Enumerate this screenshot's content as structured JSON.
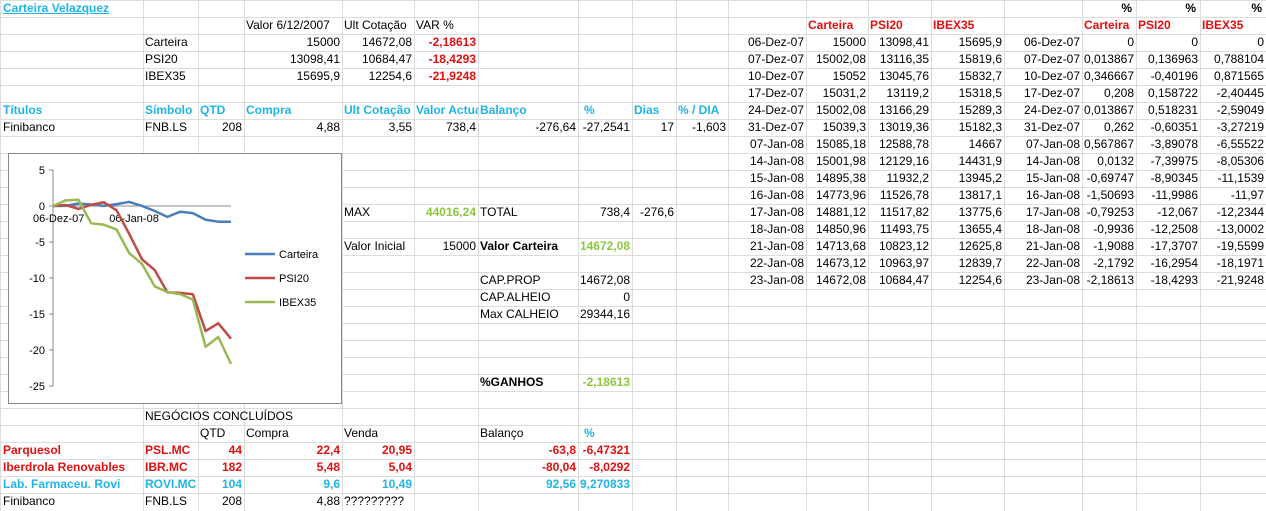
{
  "title": "Carteira Velazquez",
  "summary": {
    "h_valor": "Valor 6/12/2007",
    "h_ult": "Ult Cotação",
    "h_var": "VAR %",
    "rows": [
      {
        "name": "Carteira",
        "valor": "15000",
        "ult": "14672,08",
        "var": "-2,18613"
      },
      {
        "name": "PSI20",
        "valor": "13098,41",
        "ult": "10684,47",
        "var": "-18,4293"
      },
      {
        "name": "IBEX35",
        "valor": "15695,9",
        "ult": "12254,6",
        "var": "-21,9248"
      }
    ]
  },
  "titulos": {
    "headers": [
      "Títulos",
      "Símbolo",
      "QTD",
      "Compra",
      "Ult Cotação",
      "Valor Actual",
      "Balanço",
      "%",
      "Dias",
      "% / DIA"
    ],
    "row": {
      "name": "Finibanco",
      "sym": "FNB.LS",
      "qtd": "208",
      "compra": "4,88",
      "ult": "3,55",
      "valor": "738,4",
      "bal": "-276,64",
      "pct": "-27,2541",
      "dias": "17",
      "pdia": "-1,603"
    }
  },
  "stats": {
    "max_label": "MAX",
    "max_value": "44016,24",
    "total_label": "TOTAL",
    "total_value": "738,4",
    "total_bal": "-276,6",
    "vinicial_label": "Valor Inicial",
    "vinicial_value": "15000",
    "vcart_label": "Valor Carteira",
    "vcart_value": "14672,08",
    "capprop_label": "CAP.PROP",
    "capprop_value": "14672,08",
    "capalh_label": "CAP.ALHEIO",
    "capalh_value": "0",
    "maxcalh_label": "Max CALHEIO",
    "maxcalh_value": "29344,16",
    "ganhos_label": "%GANHOS",
    "ganhos_value": "-2,18613"
  },
  "negocios": {
    "title": "NEGÓCIOS CONCLUÍDOS",
    "headers": {
      "qtd": "QTD",
      "compra": "Compra",
      "venda": "Venda",
      "bal": "Balanço",
      "pct": "%"
    },
    "rows": [
      {
        "name": "Parquesol",
        "sym": "PSL.MC",
        "qtd": "44",
        "compra": "22,4",
        "venda": "20,95",
        "bal": "-63,8",
        "pct": "-6,47321",
        "color": "red"
      },
      {
        "name": "Iberdrola Renovables",
        "sym": "IBR.MC",
        "qtd": "182",
        "compra": "5,48",
        "venda": "5,04",
        "bal": "-80,04",
        "pct": "-8,0292",
        "color": "red"
      },
      {
        "name": "Lab. Farmaceu. Rovi",
        "sym": "ROVI.MC",
        "qtd": "104",
        "compra": "9,6",
        "venda": "10,49",
        "bal": "92,56",
        "pct": "9,270833",
        "color": "cyan"
      },
      {
        "name": "Finibanco",
        "sym": "FNB.LS",
        "qtd": "208",
        "compra": "4,88",
        "venda": "?????????",
        "bal": "",
        "pct": "",
        "color": "black"
      }
    ]
  },
  "history": {
    "headers": [
      "Carteira",
      "PSI20",
      "IBEX35"
    ],
    "pct_row": [
      "%",
      "%",
      "%"
    ],
    "rows": [
      {
        "d": "06-Dez-07",
        "c": "15000",
        "p": "13098,41",
        "i": "15695,9",
        "d2": "06-Dez-07",
        "pc": "0",
        "pp": "0",
        "pi": "0"
      },
      {
        "d": "07-Dez-07",
        "c": "15002,08",
        "p": "13116,35",
        "i": "15819,6",
        "d2": "07-Dez-07",
        "pc": "0,013867",
        "pp": "0,136963",
        "pi": "0,788104"
      },
      {
        "d": "10-Dez-07",
        "c": "15052",
        "p": "13045,76",
        "i": "15832,7",
        "d2": "10-Dez-07",
        "pc": "0,346667",
        "pp": "-0,40196",
        "pi": "0,871565"
      },
      {
        "d": "17-Dez-07",
        "c": "15031,2",
        "p": "13119,2",
        "i": "15318,5",
        "d2": "17-Dez-07",
        "pc": "0,208",
        "pp": "0,158722",
        "pi": "-2,40445"
      },
      {
        "d": "24-Dez-07",
        "c": "15002,08",
        "p": "13166,29",
        "i": "15289,3",
        "d2": "24-Dez-07",
        "pc": "0,013867",
        "pp": "0,518231",
        "pi": "-2,59049"
      },
      {
        "d": "31-Dez-07",
        "c": "15039,3",
        "p": "13019,36",
        "i": "15182,3",
        "d2": "31-Dez-07",
        "pc": "0,262",
        "pp": "-0,60351",
        "pi": "-3,27219"
      },
      {
        "d": "07-Jan-08",
        "c": "15085,18",
        "p": "12588,78",
        "i": "14667",
        "d2": "07-Jan-08",
        "pc": "0,567867",
        "pp": "-3,89078",
        "pi": "-6,55522"
      },
      {
        "d": "14-Jan-08",
        "c": "15001,98",
        "p": "12129,16",
        "i": "14431,9",
        "d2": "14-Jan-08",
        "pc": "0,0132",
        "pp": "-7,39975",
        "pi": "-8,05306"
      },
      {
        "d": "15-Jan-08",
        "c": "14895,38",
        "p": "11932,2",
        "i": "13945,2",
        "d2": "15-Jan-08",
        "pc": "-0,69747",
        "pp": "-8,90345",
        "pi": "-11,1539"
      },
      {
        "d": "16-Jan-08",
        "c": "14773,96",
        "p": "11526,78",
        "i": "13817,1",
        "d2": "16-Jan-08",
        "pc": "-1,50693",
        "pp": "-11,9986",
        "pi": "-11,97"
      },
      {
        "d": "17-Jan-08",
        "c": "14881,12",
        "p": "11517,82",
        "i": "13775,6",
        "d2": "17-Jan-08",
        "pc": "-0,79253",
        "pp": "-12,067",
        "pi": "-12,2344"
      },
      {
        "d": "18-Jan-08",
        "c": "14850,96",
        "p": "11493,75",
        "i": "13655,4",
        "d2": "18-Jan-08",
        "pc": "-0,9936",
        "pp": "-12,2508",
        "pi": "-13,0002"
      },
      {
        "d": "21-Jan-08",
        "c": "14713,68",
        "p": "10823,12",
        "i": "12625,8",
        "d2": "21-Jan-08",
        "pc": "-1,9088",
        "pp": "-17,3707",
        "pi": "-19,5599"
      },
      {
        "d": "22-Jan-08",
        "c": "14673,12",
        "p": "10963,97",
        "i": "12839,7",
        "d2": "22-Jan-08",
        "pc": "-2,1792",
        "pp": "-16,2954",
        "pi": "-18,1971"
      },
      {
        "d": "23-Jan-08",
        "c": "14672,08",
        "p": "10684,47",
        "i": "12254,6",
        "d2": "23-Jan-08",
        "pc": "-2,18613",
        "pp": "-18,4293",
        "pi": "-21,9248"
      }
    ]
  },
  "chart_data": {
    "type": "line",
    "x": [
      "06-Dez-07",
      "07-Dez-07",
      "10-Dez-07",
      "17-Dez-07",
      "24-Dez-07",
      "31-Dez-07",
      "07-Jan-08",
      "14-Jan-08",
      "15-Jan-08",
      "16-Jan-08",
      "17-Jan-08",
      "18-Jan-08",
      "21-Jan-08",
      "22-Jan-08",
      "23-Jan-08"
    ],
    "x_tick_labels": [
      "06-Dez-07",
      "06-Jan-08"
    ],
    "y_ticks": [
      "5",
      "0",
      "-5",
      "-10",
      "-15",
      "-20",
      "-25"
    ],
    "ylim": [
      -25,
      5
    ],
    "legend_position": "right",
    "series": [
      {
        "name": "Carteira",
        "color": "#4a7ebb",
        "values": [
          0,
          0.013867,
          0.346667,
          0.208,
          0.013867,
          0.262,
          0.567867,
          0.0132,
          -0.69747,
          -1.50693,
          -0.79253,
          -0.9936,
          -1.9088,
          -2.1792,
          -2.18613
        ]
      },
      {
        "name": "PSI20",
        "color": "#be4b48",
        "values": [
          0,
          0.136963,
          -0.40196,
          0.158722,
          0.518231,
          -0.60351,
          -3.89078,
          -7.39975,
          -8.90345,
          -11.9986,
          -12.067,
          -12.2508,
          -17.3707,
          -16.2954,
          -18.4293
        ]
      },
      {
        "name": "IBEX35",
        "color": "#98b954",
        "values": [
          0,
          0.788104,
          0.871565,
          -2.40445,
          -2.59049,
          -3.27219,
          -6.55522,
          -8.05306,
          -11.1539,
          -11.97,
          -12.2344,
          -13.0002,
          -19.5599,
          -18.1971,
          -21.9248
        ]
      }
    ]
  }
}
